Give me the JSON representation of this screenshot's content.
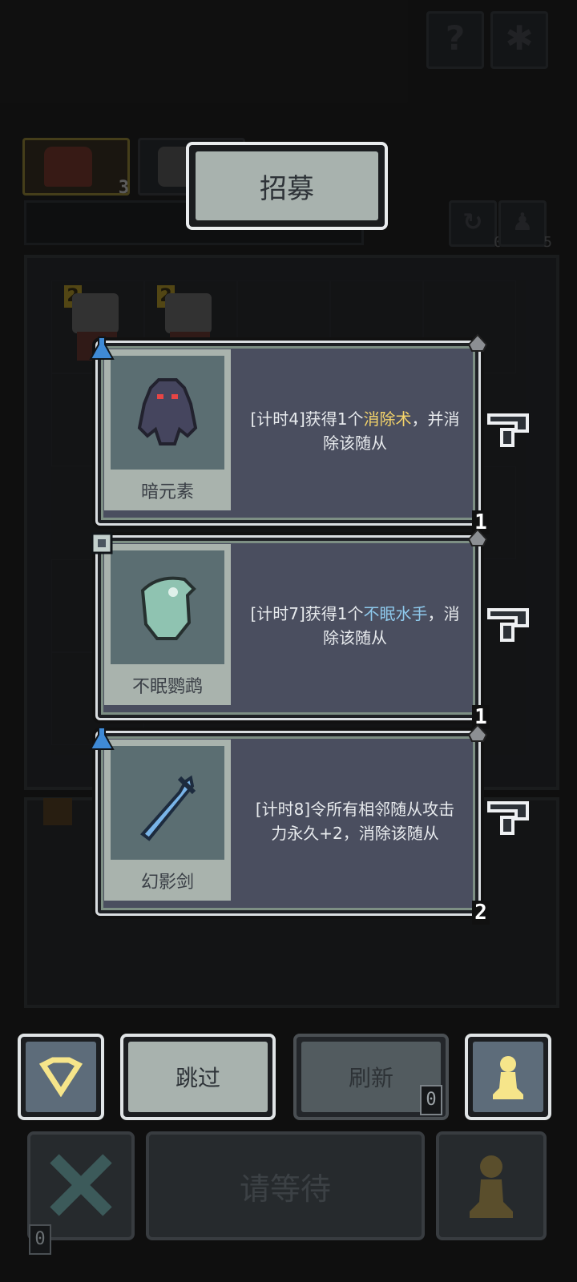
{
  "header": {
    "help_icon": "question-icon",
    "settings_icon": "gear-icon"
  },
  "recruit_title": "招募",
  "top_row": {
    "hero_counts": [
      "3"
    ],
    "counter_left": "0",
    "counter_right": "5"
  },
  "cards": [
    {
      "name": "暗元素",
      "desc_prefix": "[计时4]获得1个",
      "desc_highlight": "消除术",
      "desc_suffix": "，并消除该随从",
      "level": "1",
      "tag_icon": "potion-icon",
      "highlight_color": "#f3d36a"
    },
    {
      "name": "不眠鹦鹉",
      "desc_prefix": "[计时7]获得1个",
      "desc_highlight": "不眠水手",
      "desc_suffix": "，消除该随从",
      "level": "1",
      "tag_icon": "target-icon",
      "highlight_color": "#8ec9ec"
    },
    {
      "name": "幻影剑",
      "desc_prefix": "[计时8]令所有相邻随从攻击力永久+2，消除该随从",
      "desc_highlight": "",
      "desc_suffix": "",
      "level": "2",
      "tag_icon": "potion-icon",
      "highlight_color": "#8ec9ec"
    }
  ],
  "bottom_bar": {
    "skip_label": "跳过",
    "refresh_label": "刷新",
    "refresh_count": "0",
    "wait_label": "请等待",
    "dim_left_count": "0"
  },
  "colors": {
    "accent_yellow": "#f6e58a",
    "button_slate": "#5d6c7a",
    "button_sage": "#a8b2ae"
  }
}
